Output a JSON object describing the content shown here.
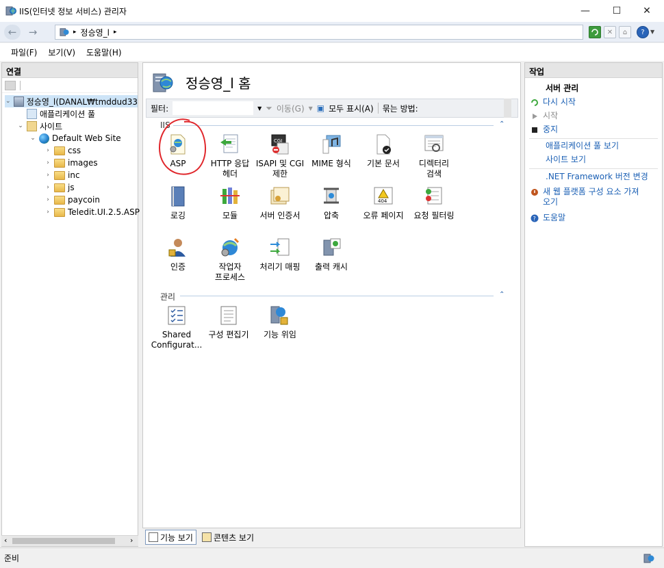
{
  "window": {
    "title": "IIS(인터넷 정보 서비스) 관리자",
    "minimize": "—",
    "maximize": "☐",
    "close": "✕"
  },
  "address": {
    "back": "←",
    "forward": "→",
    "crumb": "정승영_l",
    "sep": "▸"
  },
  "menu": [
    "파일(F)",
    "보기(V)",
    "도움말(H)"
  ],
  "left": {
    "header": "연결",
    "tree": {
      "server": "정승영_l(DANAL₩tmddud33",
      "app_pools": "애플리케이션 풀",
      "sites": "사이트",
      "default_site": "Default Web Site",
      "folders": [
        "css",
        "images",
        "inc",
        "js",
        "paycoin",
        "Teledit.UI.2.5.ASP"
      ]
    }
  },
  "center": {
    "title": "정승영_l 홈",
    "filter_label": "필터:",
    "go_label": "이동(G)",
    "show_all_label": "모두 표시(A)",
    "group_by_label": "묶는 방법:",
    "group_iis": "IIS",
    "group_manage": "관리",
    "iis_features": [
      {
        "label": "ASP",
        "icon": "asp-icon"
      },
      {
        "label": "HTTP 응답\n헤더",
        "icon": "http-headers-icon"
      },
      {
        "label": "ISAPI 및 CGI\n제한",
        "icon": "isapi-cgi-icon"
      },
      {
        "label": "MIME 형식",
        "icon": "mime-icon"
      },
      {
        "label": "기본 문서",
        "icon": "default-document-icon"
      },
      {
        "label": "디렉터리\n검색",
        "icon": "directory-browsing-icon"
      },
      {
        "label": "로깅",
        "icon": "logging-icon"
      },
      {
        "label": "모듈",
        "icon": "modules-icon"
      },
      {
        "label": "서버 인증서",
        "icon": "server-certificates-icon"
      },
      {
        "label": "압축",
        "icon": "compression-icon"
      },
      {
        "label": "오류 페이지",
        "icon": "error-pages-icon"
      },
      {
        "label": "요청 필터링",
        "icon": "request-filtering-icon"
      },
      {
        "label": "인증",
        "icon": "authentication-icon"
      },
      {
        "label": "작업자\n프로세스",
        "icon": "worker-processes-icon"
      },
      {
        "label": "처리기 매핑",
        "icon": "handler-mappings-icon"
      },
      {
        "label": "출력 캐시",
        "icon": "output-cache-icon"
      }
    ],
    "manage_features": [
      {
        "label": "Shared\nConfigurat...",
        "icon": "shared-config-icon"
      },
      {
        "label": "구성 편집기",
        "icon": "config-editor-icon"
      },
      {
        "label": "기능 위임",
        "icon": "feature-delegation-icon"
      }
    ],
    "tab_features": "기능 보기",
    "tab_content": "콘텐츠 보기"
  },
  "right": {
    "header": "작업",
    "server_manage": "서버 관리",
    "restart": "다시 시작",
    "start": "시작",
    "stop": "중지",
    "view_app_pools": "애플리케이션 풀 보기",
    "view_sites": "사이트 보기",
    "net_version": ".NET Framework 버전 변경",
    "get_web_platform": "새 웹 플랫폼 구성 요소 가져\n오기",
    "help": "도움말"
  },
  "status": {
    "text": "준비"
  },
  "colors": {
    "link": "#1a5fb4",
    "annotation_circle": "#e0262b"
  }
}
